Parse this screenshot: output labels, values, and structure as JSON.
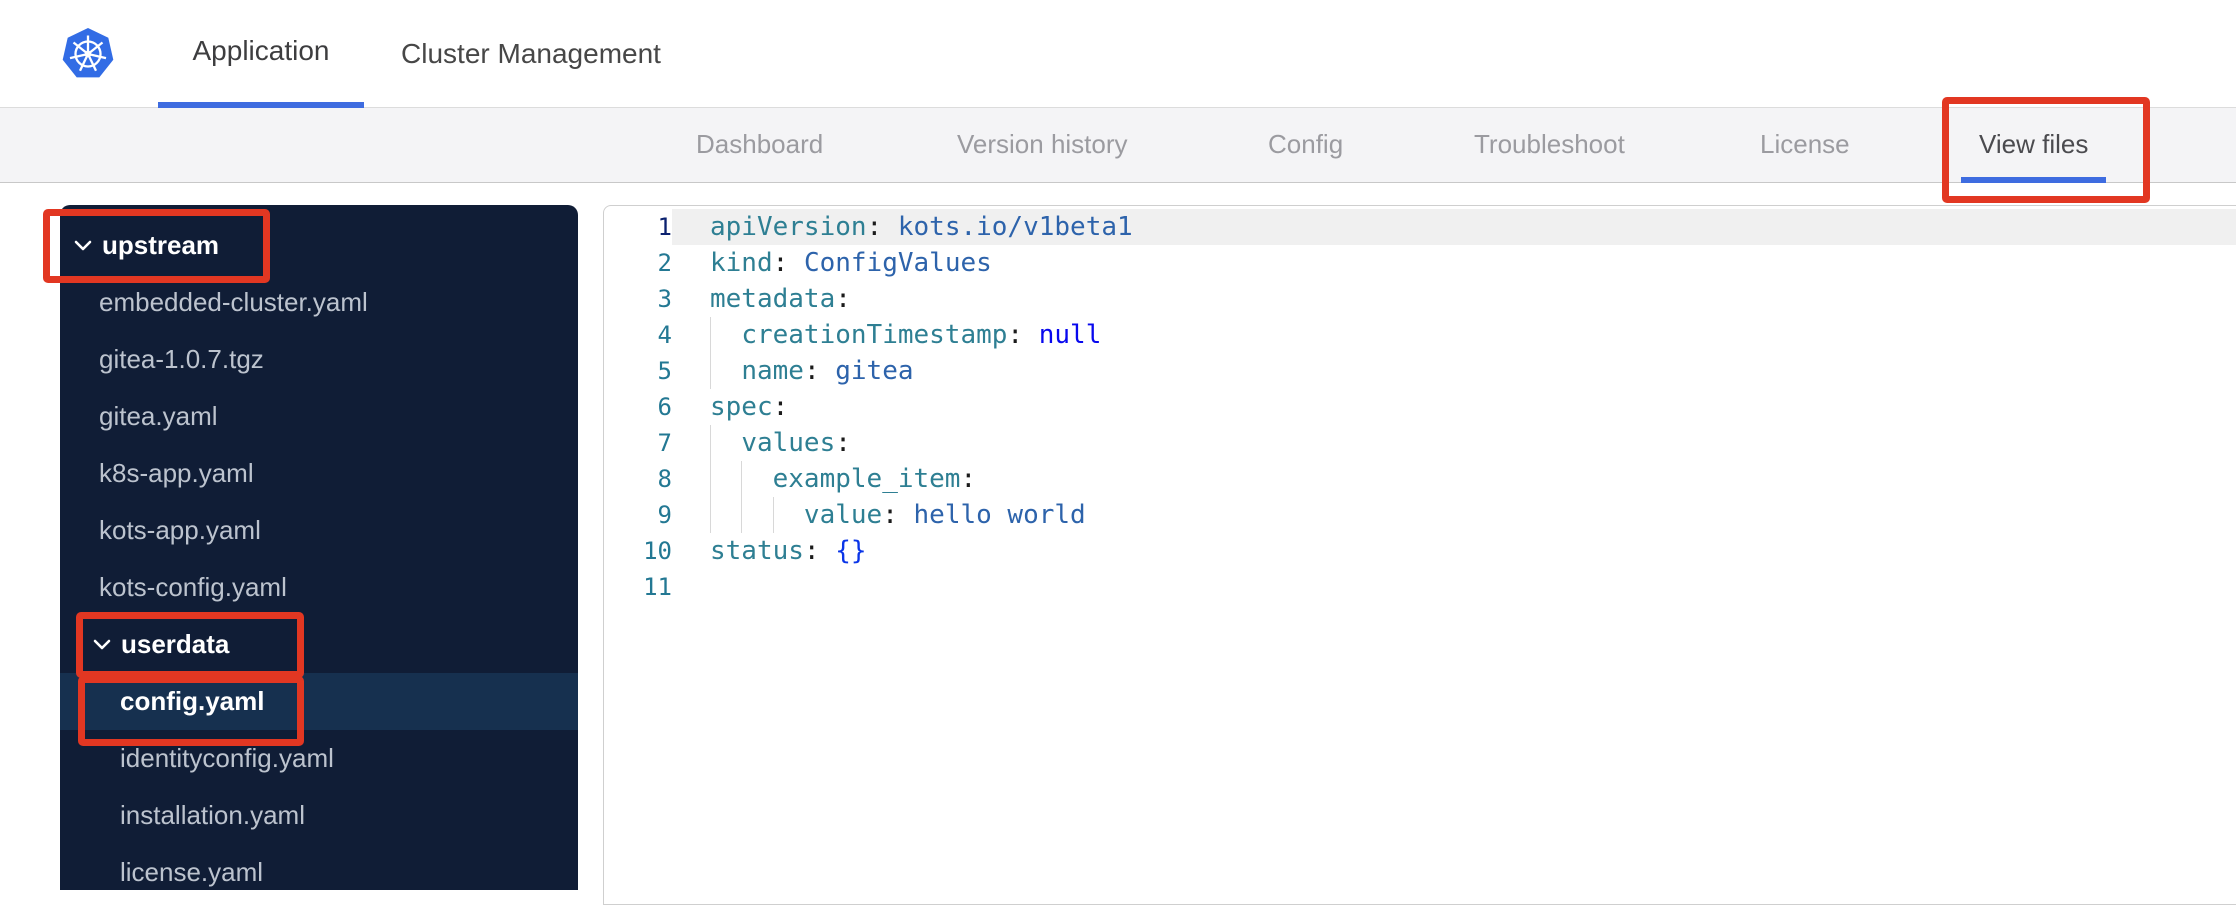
{
  "colors": {
    "accent_blue": "#3e6ce0",
    "annotation_red": "#e23722",
    "sidebar_bg": "#101d36",
    "sidebar_selected_row": "#16304f",
    "logo_blue": "#326ce5"
  },
  "header": {
    "logo_icon": "kubernetes-logo",
    "tabs": [
      {
        "label": "Application",
        "active": true
      },
      {
        "label": "Cluster Management",
        "active": false
      }
    ]
  },
  "subnav": {
    "tabs": [
      {
        "label": "Dashboard",
        "active": false
      },
      {
        "label": "Version history",
        "active": false
      },
      {
        "label": "Config",
        "active": false
      },
      {
        "label": "Troubleshoot",
        "active": false
      },
      {
        "label": "License",
        "active": false
      },
      {
        "label": "View files",
        "active": true
      }
    ]
  },
  "file_tree": {
    "items": [
      {
        "label": "upstream",
        "type": "folder",
        "level": 0,
        "expanded": true,
        "selected": false
      },
      {
        "label": "embedded-cluster.yaml",
        "type": "file",
        "level": 1,
        "selected": false
      },
      {
        "label": "gitea-1.0.7.tgz",
        "type": "file",
        "level": 1,
        "selected": false
      },
      {
        "label": "gitea.yaml",
        "type": "file",
        "level": 1,
        "selected": false
      },
      {
        "label": "k8s-app.yaml",
        "type": "file",
        "level": 1,
        "selected": false
      },
      {
        "label": "kots-app.yaml",
        "type": "file",
        "level": 1,
        "selected": false
      },
      {
        "label": "kots-config.yaml",
        "type": "file",
        "level": 1,
        "selected": false
      },
      {
        "label": "userdata",
        "type": "folder",
        "level": 1,
        "expanded": true,
        "selected": false
      },
      {
        "label": "config.yaml",
        "type": "file",
        "level": 2,
        "selected": true
      },
      {
        "label": "identityconfig.yaml",
        "type": "file",
        "level": 2,
        "selected": false
      },
      {
        "label": "installation.yaml",
        "type": "file",
        "level": 2,
        "selected": false
      },
      {
        "label": "license.yaml",
        "type": "file",
        "level": 2,
        "selected": false
      }
    ]
  },
  "editor": {
    "active_line": 1,
    "lines": [
      {
        "num": "1",
        "guides": [],
        "segments": [
          {
            "t": "apiVersion",
            "c": "key"
          },
          {
            "t": ":",
            "c": "pun"
          },
          {
            "t": " ",
            "c": "pln"
          },
          {
            "t": "kots.io/v1beta1",
            "c": "val"
          }
        ]
      },
      {
        "num": "2",
        "guides": [],
        "segments": [
          {
            "t": "kind",
            "c": "key"
          },
          {
            "t": ":",
            "c": "pun"
          },
          {
            "t": " ",
            "c": "pln"
          },
          {
            "t": "ConfigValues",
            "c": "val"
          }
        ]
      },
      {
        "num": "3",
        "guides": [],
        "segments": [
          {
            "t": "metadata",
            "c": "key"
          },
          {
            "t": ":",
            "c": "pun"
          }
        ]
      },
      {
        "num": "4",
        "guides": [
          0
        ],
        "segments": [
          {
            "t": "  ",
            "c": "pln"
          },
          {
            "t": "creationTimestamp",
            "c": "key"
          },
          {
            "t": ":",
            "c": "pun"
          },
          {
            "t": " ",
            "c": "pln"
          },
          {
            "t": "null",
            "c": "kw"
          }
        ]
      },
      {
        "num": "5",
        "guides": [
          0
        ],
        "segments": [
          {
            "t": "  ",
            "c": "pln"
          },
          {
            "t": "name",
            "c": "key"
          },
          {
            "t": ":",
            "c": "pun"
          },
          {
            "t": " ",
            "c": "pln"
          },
          {
            "t": "gitea",
            "c": "val"
          }
        ]
      },
      {
        "num": "6",
        "guides": [],
        "segments": [
          {
            "t": "spec",
            "c": "key"
          },
          {
            "t": ":",
            "c": "pun"
          }
        ]
      },
      {
        "num": "7",
        "guides": [
          0
        ],
        "segments": [
          {
            "t": "  ",
            "c": "pln"
          },
          {
            "t": "values",
            "c": "key"
          },
          {
            "t": ":",
            "c": "pun"
          }
        ]
      },
      {
        "num": "8",
        "guides": [
          0,
          2
        ],
        "segments": [
          {
            "t": "    ",
            "c": "pln"
          },
          {
            "t": "example_item",
            "c": "key"
          },
          {
            "t": ":",
            "c": "pun"
          }
        ]
      },
      {
        "num": "9",
        "guides": [
          0,
          2,
          4
        ],
        "segments": [
          {
            "t": "      ",
            "c": "pln"
          },
          {
            "t": "value",
            "c": "key"
          },
          {
            "t": ":",
            "c": "pun"
          },
          {
            "t": " ",
            "c": "pln"
          },
          {
            "t": "hello world",
            "c": "val"
          }
        ]
      },
      {
        "num": "10",
        "guides": [],
        "segments": [
          {
            "t": "status",
            "c": "key"
          },
          {
            "t": ":",
            "c": "pun"
          },
          {
            "t": " ",
            "c": "pln"
          },
          {
            "t": "{}",
            "c": "br"
          }
        ]
      },
      {
        "num": "11",
        "guides": [],
        "segments": []
      }
    ]
  },
  "annotations": [
    {
      "id": "upstream",
      "target": "upstream folder"
    },
    {
      "id": "userdata",
      "target": "userdata folder"
    },
    {
      "id": "config-yaml",
      "target": "config.yaml file"
    },
    {
      "id": "view-files",
      "target": "View files tab"
    }
  ]
}
